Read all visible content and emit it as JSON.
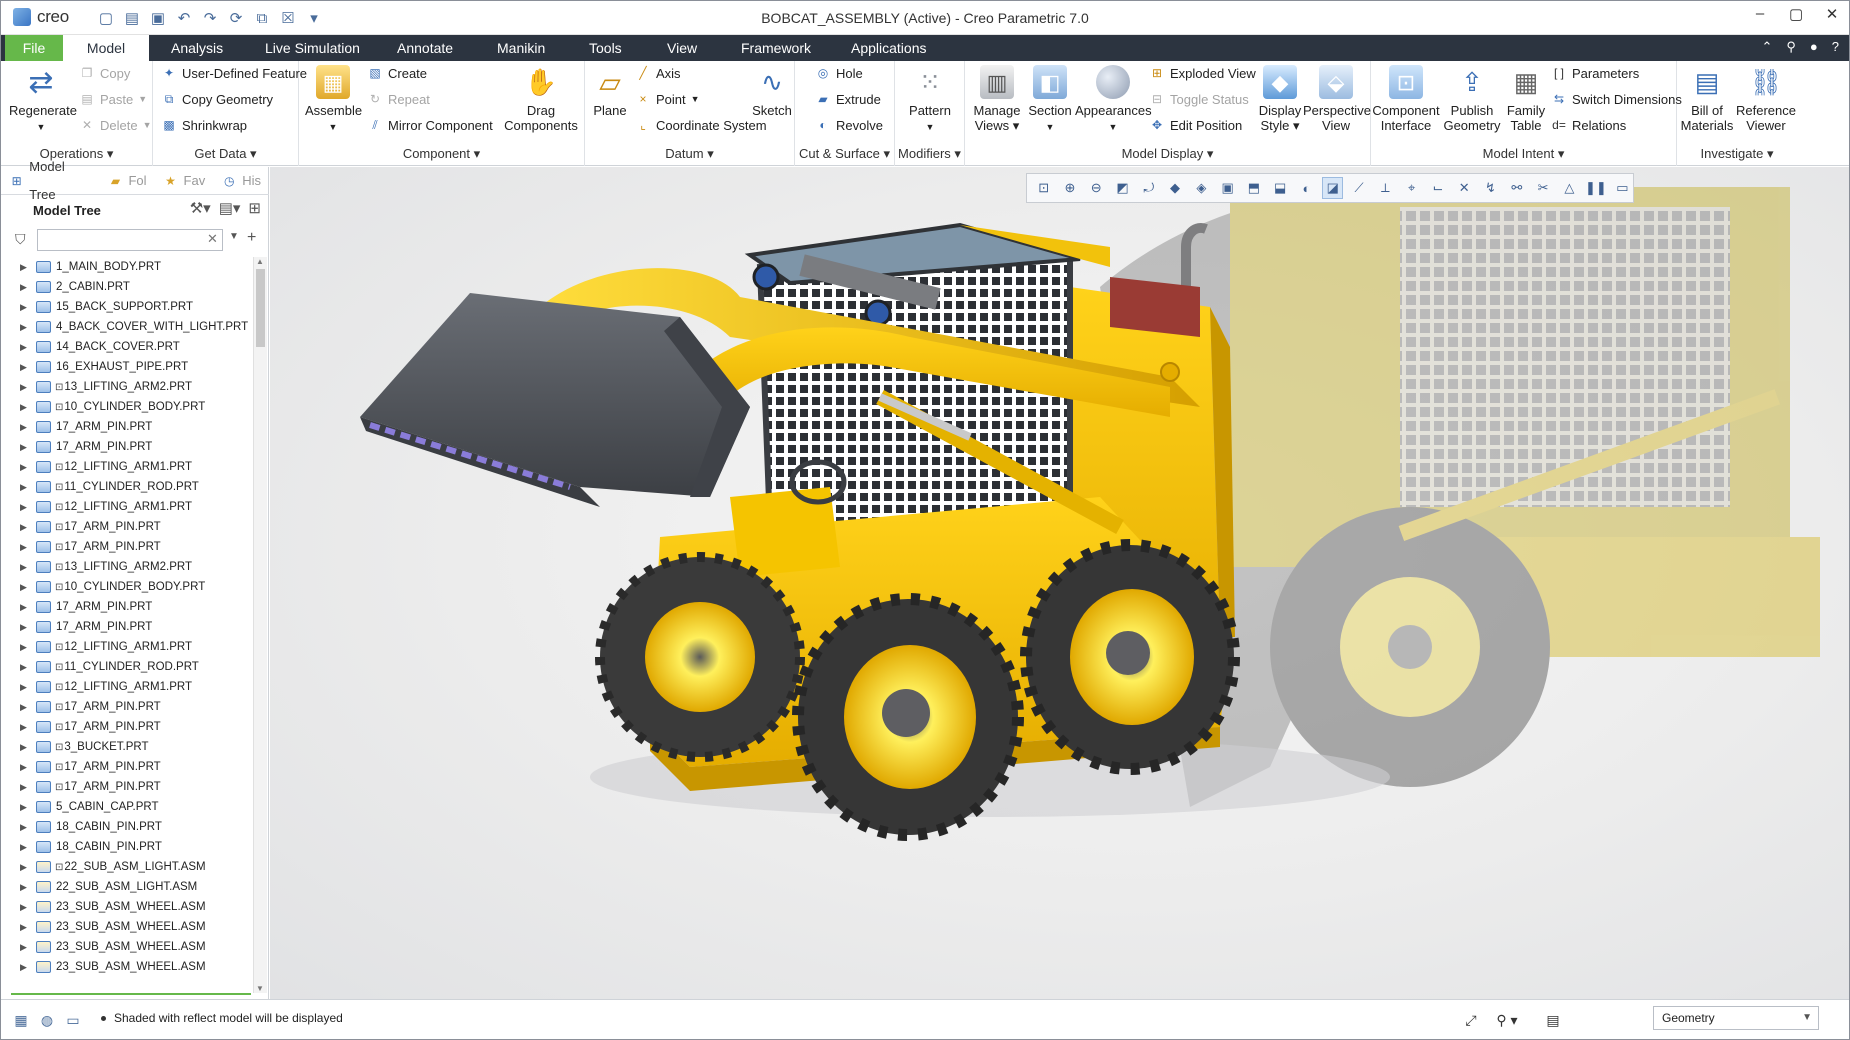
{
  "app": {
    "logo_text": "creo",
    "window_title": "BOBCAT_ASSEMBLY (Active) - Creo Parametric 7.0"
  },
  "menu": {
    "tabs": [
      {
        "label": "File"
      },
      {
        "label": "Model"
      },
      {
        "label": "Analysis"
      },
      {
        "label": "Live Simulation"
      },
      {
        "label": "Annotate"
      },
      {
        "label": "Manikin"
      },
      {
        "label": "Tools"
      },
      {
        "label": "View"
      },
      {
        "label": "Framework"
      },
      {
        "label": "Applications"
      }
    ]
  },
  "ribbon": {
    "operations": {
      "label": "Operations",
      "regenerate": "Regenerate",
      "copy": "Copy",
      "paste": "Paste",
      "delete": "Delete"
    },
    "get_data": {
      "label": "Get Data",
      "user_defined_feature": "User-Defined Feature",
      "copy_geometry": "Copy Geometry",
      "shrinkwrap": "Shrinkwrap"
    },
    "component": {
      "label": "Component",
      "assemble": "Assemble",
      "create": "Create",
      "repeat": "Repeat",
      "mirror_component": "Mirror Component",
      "drag_components_1": "Drag",
      "drag_components_2": "Components"
    },
    "datum": {
      "label": "Datum",
      "plane": "Plane",
      "axis": "Axis",
      "point": "Point",
      "coordinate_system": "Coordinate System",
      "sketch": "Sketch"
    },
    "cut_surface": {
      "label": "Cut & Surface",
      "hole": "Hole",
      "extrude": "Extrude",
      "revolve": "Revolve"
    },
    "modifiers": {
      "label": "Modifiers",
      "pattern": "Pattern"
    },
    "model_display": {
      "label": "Model Display",
      "manage_views_1": "Manage",
      "manage_views_2": "Views",
      "section": "Section",
      "appearances": "Appearances",
      "exploded_view": "Exploded View",
      "toggle_status": "Toggle Status",
      "edit_position": "Edit Position",
      "display_style_1": "Display",
      "display_style_2": "Style",
      "perspective_view_1": "Perspective",
      "perspective_view_2": "View"
    },
    "model_intent": {
      "label": "Model Intent",
      "component_interface_1": "Component",
      "component_interface_2": "Interface",
      "publish_geometry_1": "Publish",
      "publish_geometry_2": "Geometry",
      "family_table_1": "Family",
      "family_table_2": "Table",
      "parameters": "Parameters",
      "switch_dimensions": "Switch Dimensions",
      "relations": "Relations"
    },
    "investigate": {
      "label": "Investigate",
      "bill_of_materials_1": "Bill of",
      "bill_of_materials_2": "Materials",
      "reference_viewer_1": "Reference",
      "reference_viewer_2": "Viewer"
    }
  },
  "left_panel": {
    "tabs": [
      {
        "label": "Model Tree"
      },
      {
        "label": "Fol"
      },
      {
        "label": "Fav"
      },
      {
        "label": "His"
      }
    ],
    "tree_title": "Model Tree",
    "filter_placeholder": "",
    "items": [
      {
        "prefix": "",
        "name": "1_MAIN_BODY.PRT",
        "asm": false
      },
      {
        "prefix": "",
        "name": "2_CABIN.PRT",
        "asm": false
      },
      {
        "prefix": "",
        "name": "15_BACK_SUPPORT.PRT",
        "asm": false
      },
      {
        "prefix": "",
        "name": "4_BACK_COVER_WITH_LIGHT.PRT",
        "asm": false
      },
      {
        "prefix": "",
        "name": "14_BACK_COVER.PRT",
        "asm": false
      },
      {
        "prefix": "",
        "name": "16_EXHAUST_PIPE.PRT",
        "asm": false
      },
      {
        "prefix": "⊡",
        "name": "13_LIFTING_ARM2.PRT",
        "asm": false
      },
      {
        "prefix": "⊡",
        "name": "10_CYLINDER_BODY.PRT",
        "asm": false
      },
      {
        "prefix": "",
        "name": "17_ARM_PIN.PRT",
        "asm": false
      },
      {
        "prefix": "",
        "name": "17_ARM_PIN.PRT",
        "asm": false
      },
      {
        "prefix": "⊡",
        "name": "12_LIFTING_ARM1.PRT",
        "asm": false
      },
      {
        "prefix": "⊡",
        "name": "11_CYLINDER_ROD.PRT",
        "asm": false
      },
      {
        "prefix": "⊡",
        "name": "12_LIFTING_ARM1.PRT",
        "asm": false
      },
      {
        "prefix": "⊡",
        "name": "17_ARM_PIN.PRT",
        "asm": false
      },
      {
        "prefix": "⊡",
        "name": "17_ARM_PIN.PRT",
        "asm": false
      },
      {
        "prefix": "⊡",
        "name": "13_LIFTING_ARM2.PRT",
        "asm": false
      },
      {
        "prefix": "⊡",
        "name": "10_CYLINDER_BODY.PRT",
        "asm": false
      },
      {
        "prefix": "",
        "name": "17_ARM_PIN.PRT",
        "asm": false
      },
      {
        "prefix": "",
        "name": "17_ARM_PIN.PRT",
        "asm": false
      },
      {
        "prefix": "⊡",
        "name": "12_LIFTING_ARM1.PRT",
        "asm": false
      },
      {
        "prefix": "⊡",
        "name": "11_CYLINDER_ROD.PRT",
        "asm": false
      },
      {
        "prefix": "⊡",
        "name": "12_LIFTING_ARM1.PRT",
        "asm": false
      },
      {
        "prefix": "⊡",
        "name": "17_ARM_PIN.PRT",
        "asm": false
      },
      {
        "prefix": "⊡",
        "name": "17_ARM_PIN.PRT",
        "asm": false
      },
      {
        "prefix": "⊡",
        "name": "3_BUCKET.PRT",
        "asm": false
      },
      {
        "prefix": "⊡",
        "name": "17_ARM_PIN.PRT",
        "asm": false
      },
      {
        "prefix": "⊡",
        "name": "17_ARM_PIN.PRT",
        "asm": false
      },
      {
        "prefix": "",
        "name": "5_CABIN_CAP.PRT",
        "asm": false
      },
      {
        "prefix": "",
        "name": "18_CABIN_PIN.PRT",
        "asm": false
      },
      {
        "prefix": "",
        "name": "18_CABIN_PIN.PRT",
        "asm": false
      },
      {
        "prefix": "⊡",
        "name": "22_SUB_ASM_LIGHT.ASM",
        "asm": true
      },
      {
        "prefix": "",
        "name": "22_SUB_ASM_LIGHT.ASM",
        "asm": true
      },
      {
        "prefix": "",
        "name": "23_SUB_ASM_WHEEL.ASM",
        "asm": true
      },
      {
        "prefix": "",
        "name": "23_SUB_ASM_WHEEL.ASM",
        "asm": true
      },
      {
        "prefix": "",
        "name": "23_SUB_ASM_WHEEL.ASM",
        "asm": true
      },
      {
        "prefix": "",
        "name": "23_SUB_ASM_WHEEL.ASM",
        "asm": true
      }
    ]
  },
  "status": {
    "message": "Shaded with reflect model will be displayed",
    "filter_value": "Geometry"
  },
  "colors": {
    "file_tab": "#66b84a",
    "menubar": "#2c3440",
    "machine_yellow": "#f2c20c",
    "bucket_grey": "#55595f",
    "tire": "#3a3a3a"
  }
}
